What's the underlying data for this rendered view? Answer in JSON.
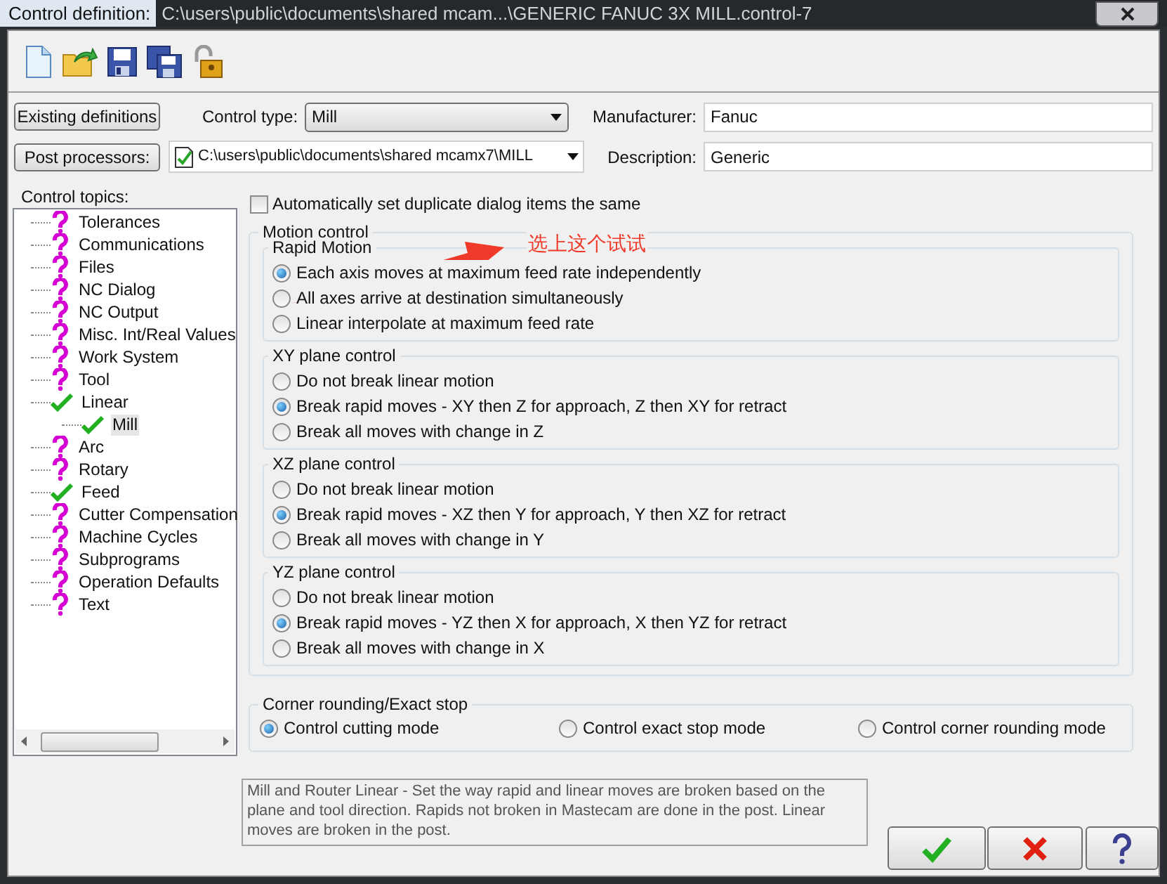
{
  "window": {
    "title_label": "Control definition:",
    "title_path": "C:\\users\\public\\documents\\shared mcam...\\GENERIC FANUC 3X MILL.control-7"
  },
  "existing_button": "Existing definitions",
  "post_button": "Post processors:",
  "control_type": {
    "label": "Control type:",
    "value": "Mill"
  },
  "post_path": {
    "value": "C:\\users\\public\\documents\\shared mcamx7\\MILL"
  },
  "manufacturer": {
    "label": "Manufacturer:",
    "value": "Fanuc"
  },
  "description": {
    "label": "Description:",
    "value": "Generic"
  },
  "topics_label": "Control topics:",
  "topics": [
    {
      "label": "Tolerances",
      "done": false,
      "selected": false
    },
    {
      "label": "Communications",
      "done": false,
      "selected": false
    },
    {
      "label": "Files",
      "done": false,
      "selected": false
    },
    {
      "label": "NC Dialog",
      "done": false,
      "selected": false
    },
    {
      "label": "NC Output",
      "done": false,
      "selected": false
    },
    {
      "label": "Misc. Int/Real Values",
      "done": false,
      "selected": false
    },
    {
      "label": "Work System",
      "done": false,
      "selected": false
    },
    {
      "label": "Tool",
      "done": false,
      "selected": false
    },
    {
      "label": "Linear",
      "done": true,
      "selected": false,
      "children": [
        {
          "label": "Mill",
          "done": true,
          "selected": true
        }
      ]
    },
    {
      "label": "Arc",
      "done": false,
      "selected": false
    },
    {
      "label": "Rotary",
      "done": false,
      "selected": false
    },
    {
      "label": "Feed",
      "done": true,
      "selected": false
    },
    {
      "label": "Cutter Compensation",
      "done": false,
      "selected": false
    },
    {
      "label": "Machine Cycles",
      "done": false,
      "selected": false
    },
    {
      "label": "Subprograms",
      "done": false,
      "selected": false
    },
    {
      "label": "Operation Defaults",
      "done": false,
      "selected": false
    },
    {
      "label": "Text",
      "done": false,
      "selected": false
    }
  ],
  "duplicate_checkbox": {
    "label": "Automatically set duplicate dialog items the same",
    "checked": false
  },
  "motion_control": {
    "title": "Motion control",
    "groups": [
      {
        "title": "Rapid Motion",
        "options": [
          {
            "label": "Each axis moves at maximum feed rate independently",
            "selected": true
          },
          {
            "label": "All axes arrive at destination simultaneously",
            "selected": false
          },
          {
            "label": "Linear interpolate at maximum feed rate",
            "selected": false
          }
        ]
      },
      {
        "title": "XY plane control",
        "options": [
          {
            "label": "Do not break linear motion",
            "selected": false
          },
          {
            "label": "Break rapid moves - XY then Z for approach, Z then XY for retract",
            "selected": true
          },
          {
            "label": "Break all moves with change in Z",
            "selected": false
          }
        ]
      },
      {
        "title": "XZ plane control",
        "options": [
          {
            "label": "Do not break linear motion",
            "selected": false
          },
          {
            "label": "Break rapid moves - XZ then Y for approach, Y then XZ for retract",
            "selected": true
          },
          {
            "label": "Break all moves with change in Y",
            "selected": false
          }
        ]
      },
      {
        "title": "YZ plane control",
        "options": [
          {
            "label": "Do not break linear motion",
            "selected": false
          },
          {
            "label": "Break rapid moves - YZ then X for approach, X then YZ for retract",
            "selected": true
          },
          {
            "label": "Break all moves with change in X",
            "selected": false
          }
        ]
      }
    ]
  },
  "corner": {
    "title": "Corner rounding/Exact stop",
    "options": [
      {
        "label": "Control cutting mode",
        "selected": true
      },
      {
        "label": "Control exact stop mode",
        "selected": false
      },
      {
        "label": "Control corner rounding mode",
        "selected": false
      }
    ]
  },
  "help_text": "Mill and Router Linear - Set the way rapid and linear moves are broken based on the plane and tool direction.  Rapids not broken in Mastecam are done in the post.  Linear moves are broken in the post.",
  "dialog_buttons": [
    {
      "kind": "ok"
    },
    {
      "kind": "cancel"
    },
    {
      "kind": "help"
    }
  ],
  "annotation": {
    "text": "选上这个试试"
  }
}
